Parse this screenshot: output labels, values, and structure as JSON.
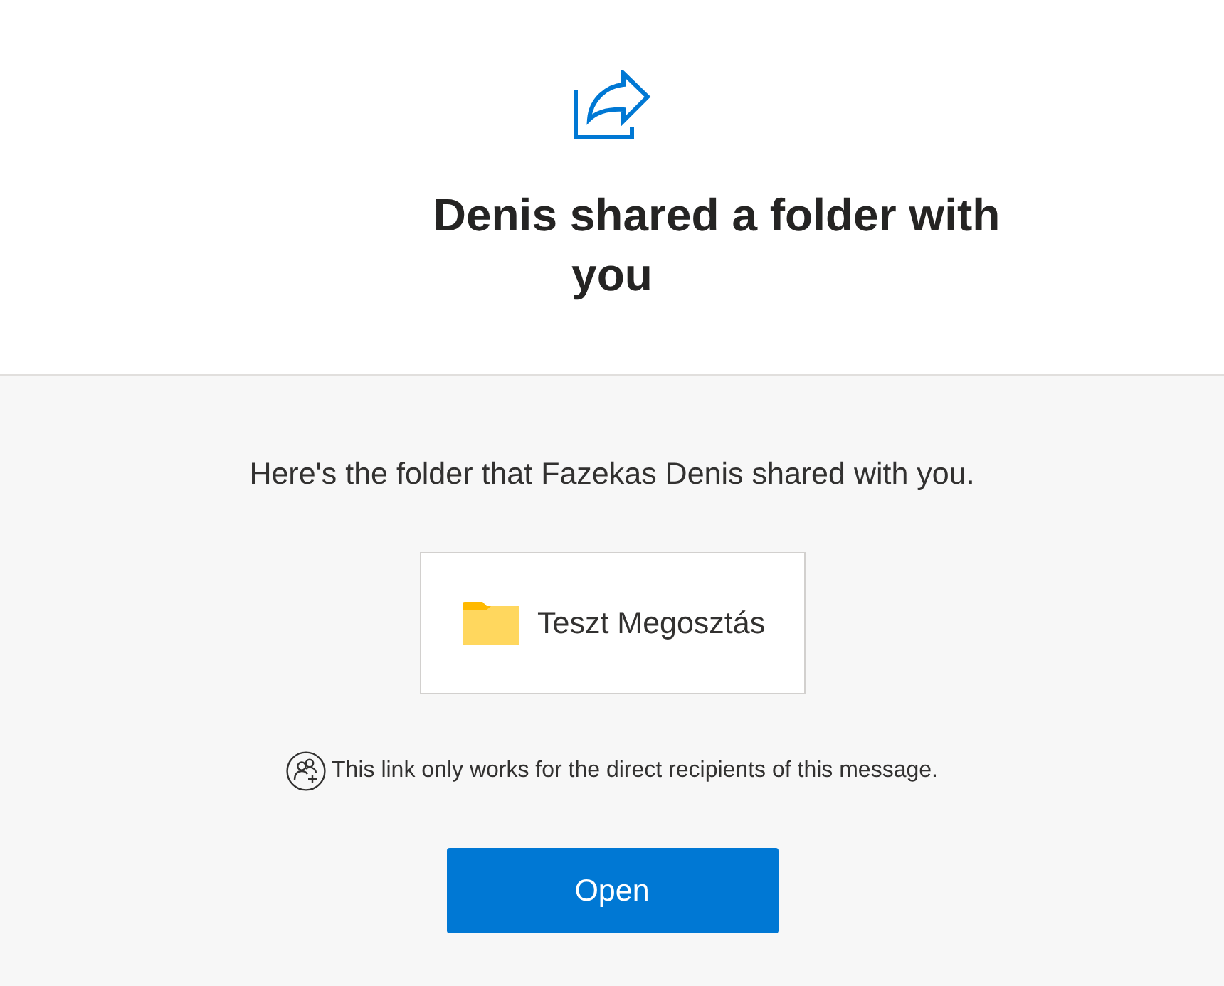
{
  "header": {
    "title": "Denis shared a folder with you"
  },
  "message": "Here's the folder that Fazekas Denis shared with you.",
  "folder": {
    "name": "Teszt Megosztás"
  },
  "notice": "This link only works for the direct recipients of this message.",
  "button": {
    "label": "Open"
  }
}
